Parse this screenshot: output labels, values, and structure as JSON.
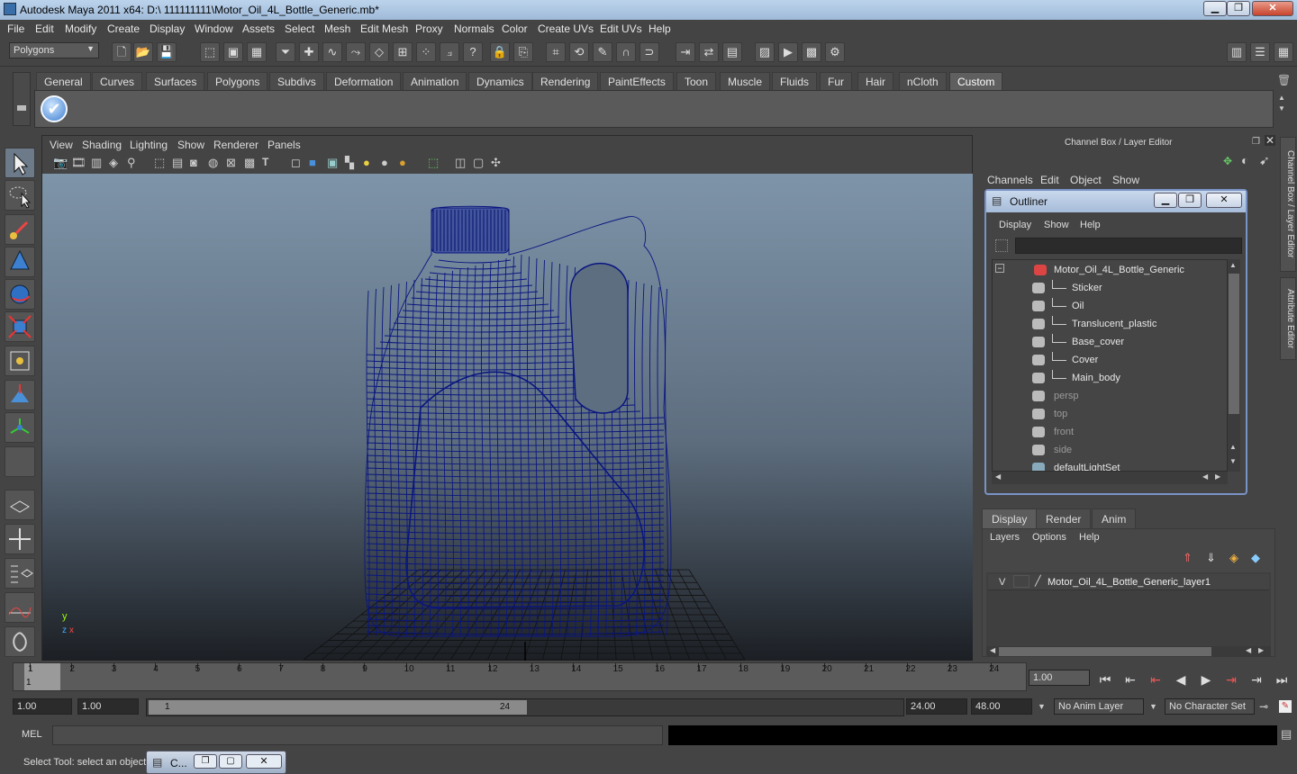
{
  "window": {
    "title": "Autodesk Maya 2011 x64: D:\\ 111111111\\Motor_Oil_4L_Bottle_Generic.mb*",
    "minimize": "▁",
    "maximize": "❐",
    "close": "✕"
  },
  "menubar": [
    "File",
    "Edit",
    "Modify",
    "Create",
    "Display",
    "Window",
    "Assets",
    "Select",
    "Mesh",
    "Edit Mesh",
    "Proxy",
    "Normals",
    "Color",
    "Create UVs",
    "Edit UVs",
    "Help"
  ],
  "statusline": {
    "mode": "Polygons"
  },
  "shelf": {
    "tabs": [
      "General",
      "Curves",
      "Surfaces",
      "Polygons",
      "Subdivs",
      "Deformation",
      "Animation",
      "Dynamics",
      "Rendering",
      "PaintEffects",
      "Toon",
      "Muscle",
      "Fluids",
      "Fur",
      "Hair",
      "nCloth",
      "Custom"
    ],
    "active": "Custom"
  },
  "viewport": {
    "menus": [
      "View",
      "Shading",
      "Lighting",
      "Show",
      "Renderer",
      "Panels"
    ],
    "axis_y": "y",
    "axis_x": "x",
    "axis_z": "z"
  },
  "channelbox": {
    "title": "Channel Box / Layer Editor",
    "menus": [
      "Channels",
      "Edit",
      "Object",
      "Show"
    ]
  },
  "outliner": {
    "title": "Outliner",
    "menus": [
      "Display",
      "Show",
      "Help"
    ],
    "items": [
      {
        "label": "Motor_Oil_4L_Bottle_Generic",
        "level": 0,
        "gray": false
      },
      {
        "label": "Sticker",
        "level": 1,
        "gray": false
      },
      {
        "label": "Oil",
        "level": 1,
        "gray": false
      },
      {
        "label": "Translucent_plastic",
        "level": 1,
        "gray": false
      },
      {
        "label": "Base_cover",
        "level": 1,
        "gray": false
      },
      {
        "label": "Cover",
        "level": 1,
        "gray": false
      },
      {
        "label": "Main_body",
        "level": 1,
        "gray": false
      },
      {
        "label": "persp",
        "level": 0,
        "gray": true
      },
      {
        "label": "top",
        "level": 0,
        "gray": true
      },
      {
        "label": "front",
        "level": 0,
        "gray": true
      },
      {
        "label": "side",
        "level": 0,
        "gray": true
      },
      {
        "label": "defaultLightSet",
        "level": 0,
        "gray": false
      }
    ]
  },
  "layereditor": {
    "tabs": [
      "Display",
      "Render",
      "Anim"
    ],
    "active": "Display",
    "menus": [
      "Layers",
      "Options",
      "Help"
    ],
    "layer": {
      "visible": "V",
      "name": "Motor_Oil_4L_Bottle_Generic_layer1"
    }
  },
  "sidetabs": [
    "Channel Box / Layer Editor",
    "Attribute Editor"
  ],
  "timeline": {
    "frames": [
      "1",
      "2",
      "3",
      "4",
      "5",
      "6",
      "7",
      "8",
      "9",
      "10",
      "11",
      "12",
      "13",
      "14",
      "15",
      "16",
      "17",
      "18",
      "19",
      "20",
      "21",
      "22",
      "23",
      "24"
    ],
    "current_frame": "1",
    "current_time": "1.00"
  },
  "range": {
    "start": "1.00",
    "playback_start": "1.00",
    "slider_start": "1",
    "slider_end": "24",
    "playback_end": "24.00",
    "end": "48.00",
    "anim_layer": "No Anim Layer",
    "character_set": "No Character Set"
  },
  "cmdline": {
    "label": "MEL"
  },
  "helpline": {
    "text": "Select Tool: select an object",
    "task_label": "C..."
  }
}
